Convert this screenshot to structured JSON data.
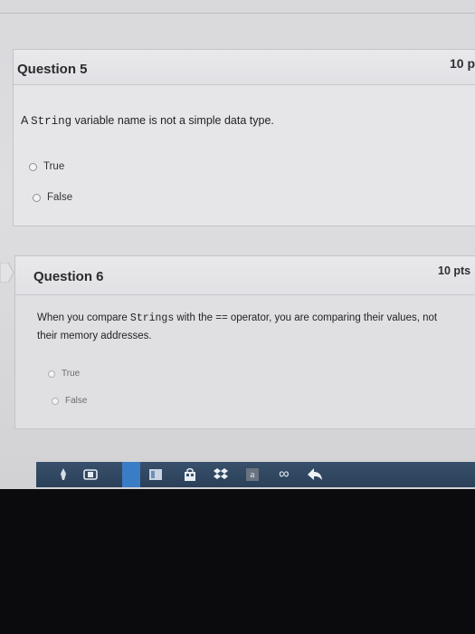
{
  "questions": [
    {
      "title": "Question 5",
      "points": "10 p",
      "text_prefix": "A ",
      "text_code": "String",
      "text_suffix": " variable name is not a simple data type.",
      "answers": [
        "True",
        "False"
      ]
    },
    {
      "title": "Question 6",
      "points": "10 pts",
      "text_line1_prefix": "When you compare ",
      "text_line1_code": "Strings",
      "text_line1_suffix": " with the == operator, you are comparing their values, not",
      "text_line2": "their memory addresses.",
      "answers": [
        "True",
        "False"
      ]
    }
  ],
  "taskbar": {
    "icons": [
      "pen-icon",
      "phone-icon",
      "app-icon",
      "store-icon",
      "dropbox-icon",
      "amazon-icon",
      "infinity-icon",
      "reply-icon"
    ],
    "amazon_glyph": "a",
    "infinity_glyph": "∞"
  }
}
